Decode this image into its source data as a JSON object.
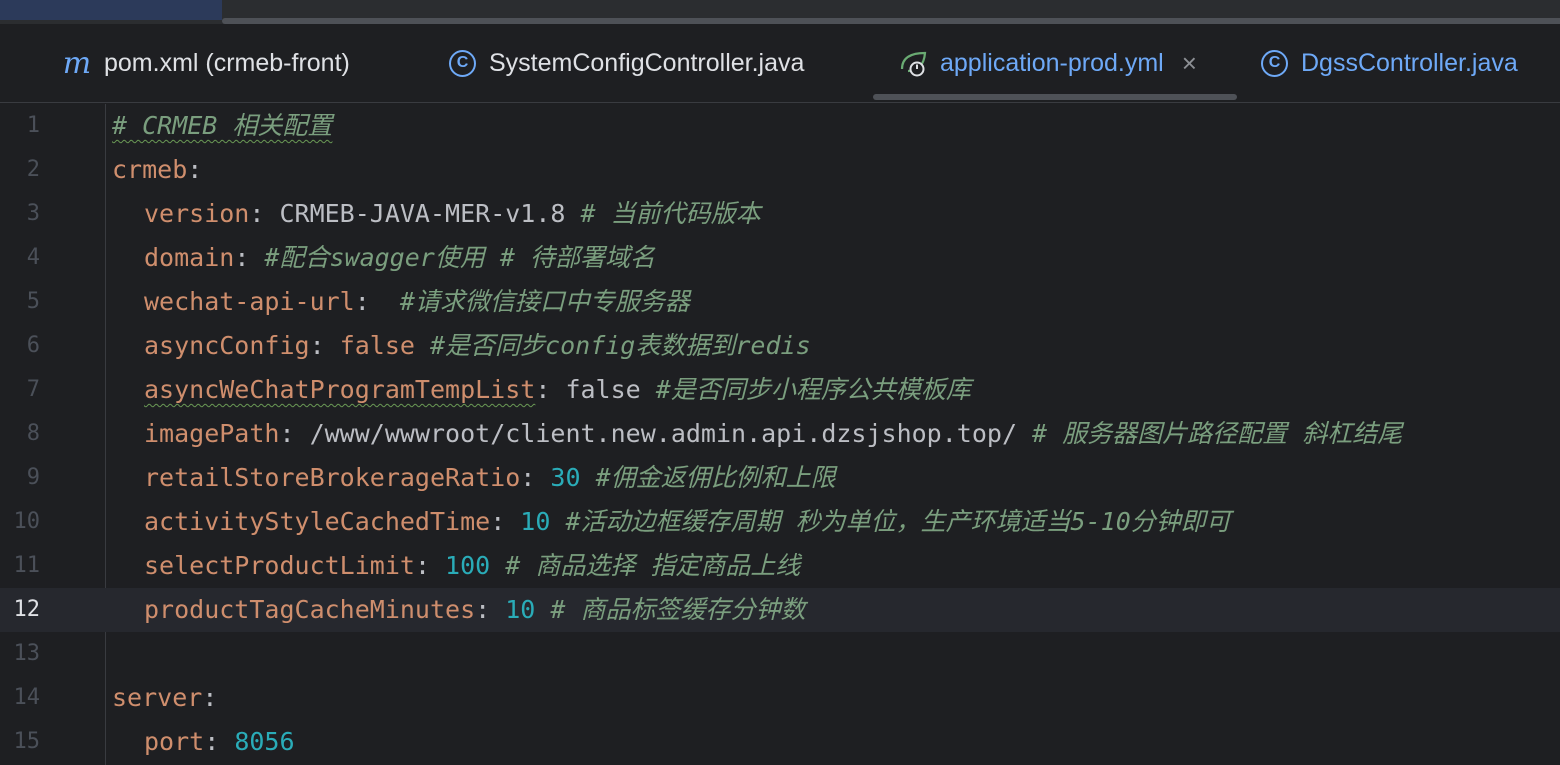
{
  "tabs": [
    {
      "icon": "maven-icon",
      "label": "pom.xml (crmeb-front)",
      "active": false
    },
    {
      "icon": "class-icon",
      "label": "SystemConfigController.java",
      "active": false
    },
    {
      "icon": "spring-yaml-icon",
      "label": "application-prod.yml",
      "active": true,
      "close": "×"
    },
    {
      "icon": "class-icon",
      "label": "DgssController.java",
      "active": false
    }
  ],
  "icons": {
    "maven": "m",
    "class": "C"
  },
  "editor": {
    "current_line": "12",
    "lines": [
      {
        "num": "1",
        "comment": "# CRMEB 相关配置"
      },
      {
        "num": "2",
        "key": "crmeb",
        "colon": ":"
      },
      {
        "num": "3",
        "key": "version",
        "colon": ":",
        "value": " CRMEB-JAVA-MER-v1.8",
        "comment": " # 当前代码版本"
      },
      {
        "num": "4",
        "key": "domain",
        "colon": ":",
        "comment": " #配合swagger使用 # 待部署域名"
      },
      {
        "num": "5",
        "key": "wechat-api-url",
        "colon": ":",
        "comment": "  #请求微信接口中专服务器"
      },
      {
        "num": "6",
        "key": "asyncConfig",
        "colon": ":",
        "value": " false",
        "comment": " #是否同步config表数据到redis"
      },
      {
        "num": "7",
        "key": "asyncWeChatProgramTempList",
        "colon": ":",
        "value": " false",
        "comment": " #是否同步小程序公共模板库"
      },
      {
        "num": "8",
        "key": "imagePath",
        "colon": ":",
        "value": " /www/wwwroot/client.new.admin.api.dzsjshop.top/",
        "comment": " # 服务器图片路径配置 斜杠结尾"
      },
      {
        "num": "9",
        "key": "retailStoreBrokerageRatio",
        "colon": ":",
        "value": " 30",
        "comment": " #佣金返佣比例和上限"
      },
      {
        "num": "10",
        "key": "activityStyleCachedTime",
        "colon": ":",
        "value": " 10",
        "comment": " #活动边框缓存周期 秒为单位，生产环境适当5-10分钟即可"
      },
      {
        "num": "11",
        "key": "selectProductLimit",
        "colon": ":",
        "value": " 100",
        "comment": " # 商品选择 指定商品上线"
      },
      {
        "num": "12",
        "key": "productTagCacheMinutes",
        "colon": ":",
        "value": " 10",
        "comment": " # 商品标签缓存分钟数"
      },
      {
        "num": "13"
      },
      {
        "num": "14",
        "key": "server",
        "colon": ":"
      },
      {
        "num": "15",
        "key": "port",
        "colon": ":",
        "value": " 8056"
      }
    ]
  }
}
